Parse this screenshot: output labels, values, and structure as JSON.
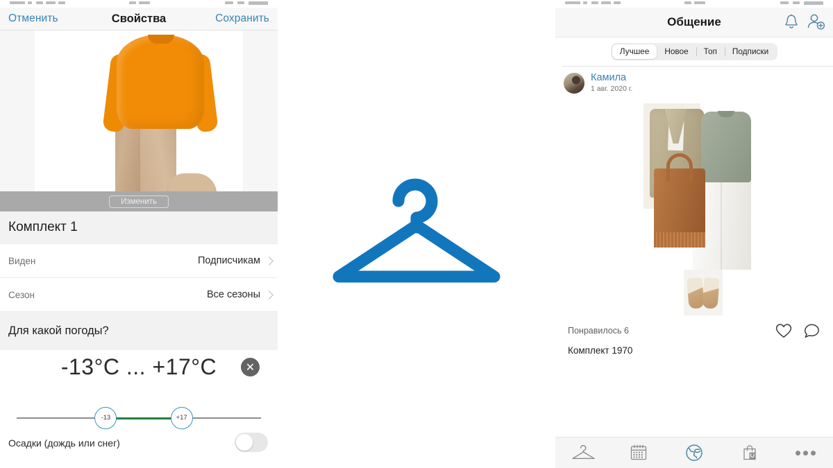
{
  "left_panel": {
    "navbar": {
      "cancel_label": "Отменить",
      "title": "Свойства",
      "save_label": "Сохранить"
    },
    "hero": {
      "edit_button_label": "Изменить"
    },
    "outfit_name": "Комплект 1",
    "properties": [
      {
        "label": "Виден",
        "value": "Подписчикам"
      },
      {
        "label": "Сезон",
        "value": "Все сезоны"
      }
    ],
    "weather": {
      "section_title": "Для какой погоды?",
      "range_display": "-13°C ... +17°C",
      "min_label": "-13",
      "max_label": "+17",
      "min_value": -13,
      "max_value": 17,
      "clear_icon": "✕",
      "precipitation_label": "Осадки (дождь или снег)",
      "precipitation_on": false
    }
  },
  "center": {
    "logo_name": "hanger-logo",
    "logo_color": "#1276bc"
  },
  "right_panel": {
    "navbar": {
      "title": "Общение",
      "bell_icon": "bell-icon",
      "add_user_icon": "add-user-icon"
    },
    "segments": [
      {
        "label": "Лучшее",
        "active": true
      },
      {
        "label": "Новое",
        "active": false
      },
      {
        "label": "Топ",
        "active": false
      },
      {
        "label": "Подписки",
        "active": false
      }
    ],
    "post": {
      "author": "Камила",
      "date": "1 авг. 2020 г.",
      "likes_text": "Понравилось 6",
      "likes_count": 6,
      "caption": "Комплект 1970",
      "like_icon": "heart-icon",
      "comment_icon": "comment-icon"
    },
    "tabbar": [
      {
        "name": "hanger",
        "active": false
      },
      {
        "name": "calendar",
        "active": false
      },
      {
        "name": "globe",
        "active": true
      },
      {
        "name": "shop",
        "active": false
      },
      {
        "name": "more",
        "active": false
      }
    ]
  },
  "colors": {
    "accent_blue": "#3683b5",
    "logo_blue": "#1276bc",
    "slider_green": "#23803c",
    "slider_knob_border": "#3c90c4"
  }
}
